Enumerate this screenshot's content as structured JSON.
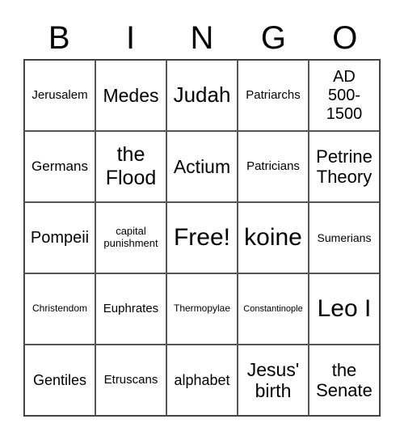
{
  "header": [
    "B",
    "I",
    "N",
    "G",
    "O"
  ],
  "cells": [
    [
      "Jerusalem",
      "Medes",
      "Judah",
      "Patriarchs",
      "AD 500-1500"
    ],
    [
      "Germans",
      "the Flood",
      "Actium",
      "Patricians",
      "Petrine Theory"
    ],
    [
      "Pompeii",
      "capital punishment",
      "Free!",
      "koine",
      "Sumerians"
    ],
    [
      "Christendom",
      "Euphrates",
      "Thermopylae",
      "Constantinople",
      "Leo I"
    ],
    [
      "Gentiles",
      "Etruscans",
      "alphabet",
      "Jesus' birth",
      "the Senate"
    ]
  ]
}
